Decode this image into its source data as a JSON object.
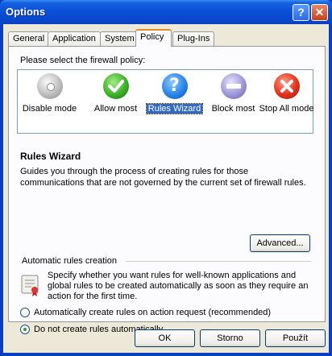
{
  "window": {
    "title": "Options"
  },
  "titlebar_buttons": {
    "help": "?",
    "close": "✕"
  },
  "tabs": [
    {
      "label": "General"
    },
    {
      "label": "Application"
    },
    {
      "label": "System"
    },
    {
      "label": "Policy"
    },
    {
      "label": "Plug-Ins"
    }
  ],
  "active_tab": "Policy",
  "policy": {
    "prompt": "Please select the firewall policy:",
    "modes": [
      {
        "label": "Disable mode",
        "icon": "disable-mode-icon"
      },
      {
        "label": "Allow most",
        "icon": "allow-most-icon"
      },
      {
        "label": "Rules Wizard",
        "icon": "rules-wizard-icon"
      },
      {
        "label": "Block most",
        "icon": "block-most-icon"
      },
      {
        "label": "Stop All mode",
        "icon": "stop-all-icon"
      }
    ],
    "selected": "Rules Wizard",
    "heading": "Rules Wizard",
    "description": "Guides you through the process of creating rules for those communications that are not governed by the current set of firewall rules.",
    "advanced_label": "Advanced..."
  },
  "auto_rules": {
    "title": "Automatic rules creation",
    "description": "Specify whether you want rules for well-known applications and global rules to be created automatically as soon as they require an action for the first time.",
    "options": [
      {
        "label": "Automatically create rules on action request (recommended)",
        "checked": false
      },
      {
        "label": "Do not create rules automatically",
        "checked": true
      }
    ]
  },
  "footer": {
    "ok": "OK",
    "cancel": "Storno",
    "apply": "Použít"
  }
}
